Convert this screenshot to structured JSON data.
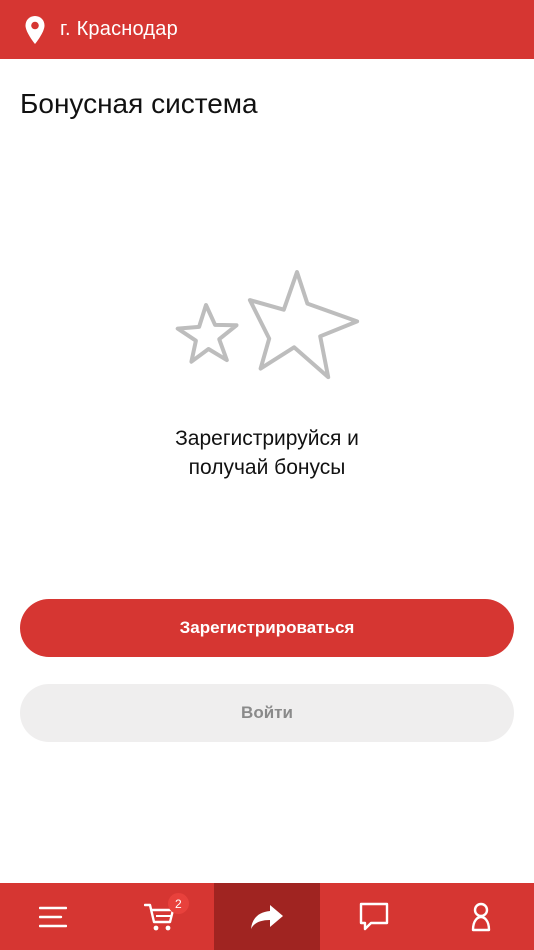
{
  "header": {
    "city": "г. Краснодар",
    "icon": "location-pin-icon"
  },
  "page": {
    "title": "Бонусная система"
  },
  "promo": {
    "line1": "Зарегистрируйся и",
    "line2": "получай бонусы",
    "icon": "stars-icon"
  },
  "actions": {
    "register_label": "Зарегистрироваться",
    "login_label": "Войти"
  },
  "tabbar": {
    "cart_badge": "2",
    "items": [
      {
        "icon": "menu-icon"
      },
      {
        "icon": "cart-icon"
      },
      {
        "icon": "share-icon",
        "active": true
      },
      {
        "icon": "chat-icon"
      },
      {
        "icon": "profile-icon"
      }
    ]
  },
  "colors": {
    "brand": "#d63632",
    "brand_dark": "#a02421",
    "secondary_button": "#efeeee",
    "star_outline": "#bdbdbd"
  }
}
